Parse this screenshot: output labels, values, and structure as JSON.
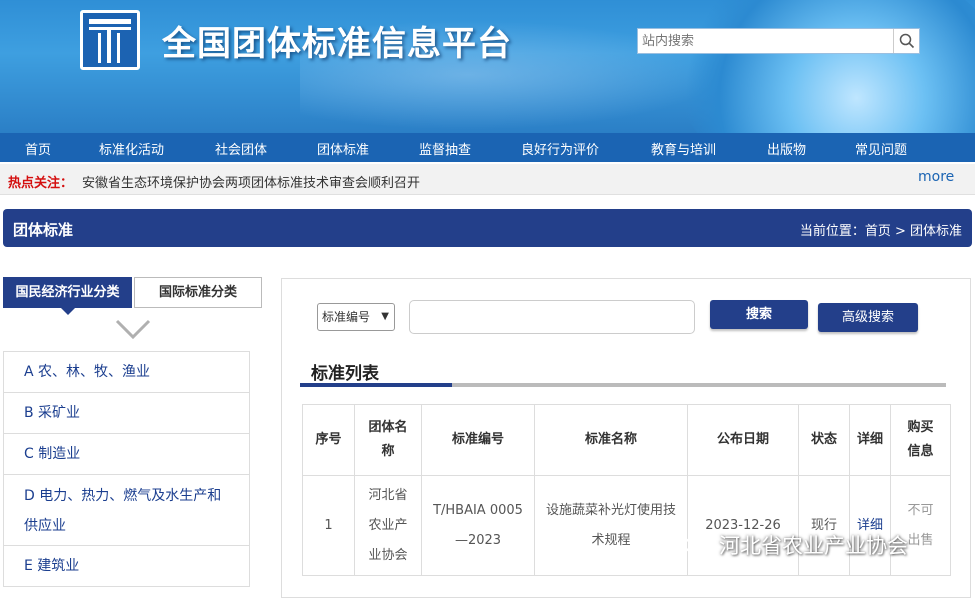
{
  "header": {
    "site_title": "全国团体标准信息平台",
    "search_placeholder": "站内搜索"
  },
  "nav": [
    "首页",
    "标准化活动",
    "社会团体",
    "团体标准",
    "监督抽查",
    "良好行为评价",
    "教育与培训",
    "出版物",
    "常见问题"
  ],
  "hot": {
    "label": "热点关注：",
    "news": "安徽省生态环境保护协会两项团体标准技术审查会顺利召开",
    "more": "more"
  },
  "section": {
    "title": "团体标准",
    "breadcrumb": "当前位置：首页 > 团体标准"
  },
  "left": {
    "tab_active": "国民经济行业分类",
    "tab_other": "国际标准分类",
    "categories": [
      "A 农、林、牧、渔业",
      "B 采矿业",
      "C 制造业",
      "D 电力、热力、燃气及水生产和供应业",
      "E 建筑业"
    ]
  },
  "search": {
    "select_value": "标准编号",
    "search_button": "搜索",
    "advanced_button": "高级搜索"
  },
  "list": {
    "heading": "标准列表",
    "headers": [
      "序号",
      "团体名称",
      "标准编号",
      "标准名称",
      "公布日期",
      "状态",
      "详细",
      "购买信息"
    ],
    "rows": [
      {
        "no": "1",
        "org": "河北省农业产业协会",
        "code": "T/HBAIA 0005—2023",
        "name": "设施蔬菜补光灯使用技术规程",
        "date": "2023-12-26",
        "status": "现行",
        "detail": "详细",
        "buy": "不可出售"
      }
    ]
  },
  "watermark": "河北省农业产业协会",
  "colors": {
    "nav_blue": "#1b64b3",
    "dark_blue": "#233f8a",
    "hot_red": "#d40f0f"
  }
}
